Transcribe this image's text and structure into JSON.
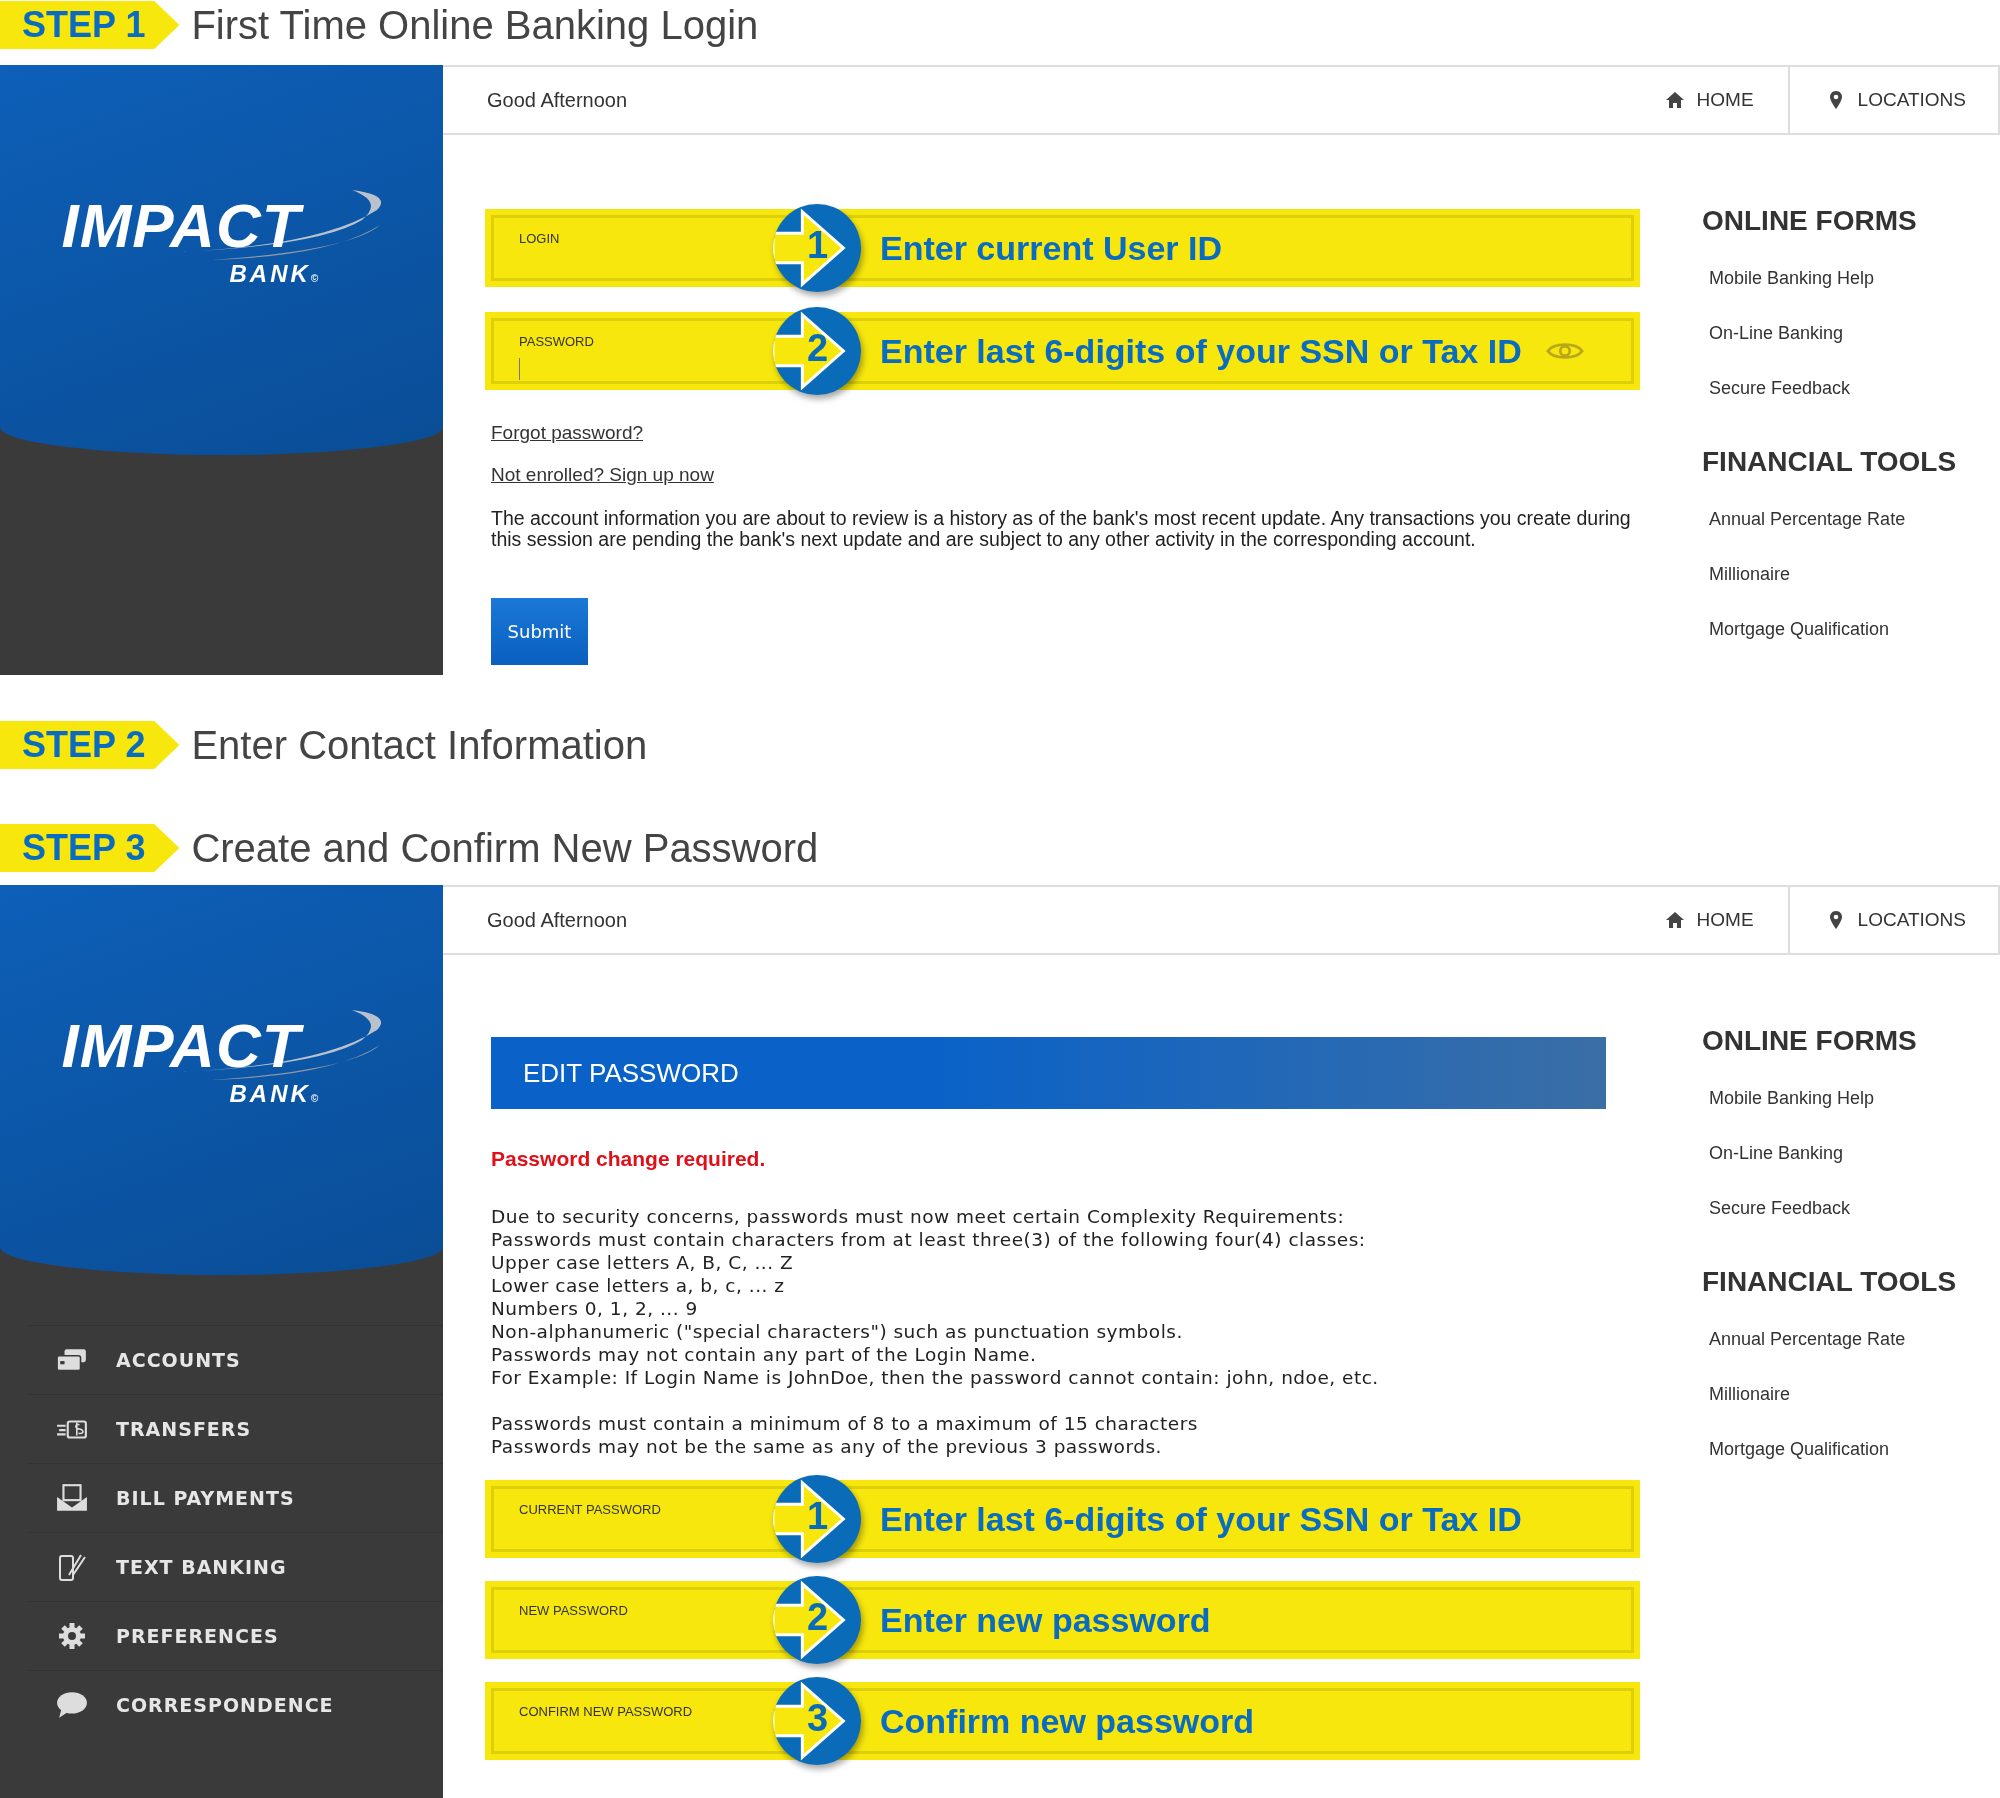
{
  "step_1": {
    "label": "STEP 1",
    "title": "First Time Online Banking Login"
  },
  "login_screen": {
    "logo": {
      "name": "IMPACT",
      "sub": "BANK",
      "mark": "©"
    },
    "greeting": "Good Afternoon",
    "top_nav": [
      {
        "label": "HOME"
      },
      {
        "label": "LOCATIONS"
      }
    ],
    "fields": [
      {
        "label": "LOGIN",
        "number": "1",
        "instruction": "Enter current User ID",
        "focused": false,
        "reveal_toggle": false
      },
      {
        "label": "PASSWORD",
        "number": "2",
        "instruction": "Enter last 6-digits of your SSN or Tax ID",
        "focused": true,
        "reveal_toggle": true
      }
    ],
    "links": [
      "Forgot password?",
      "Not enrolled? Sign up now"
    ],
    "notice": "The account information you are about to review is a history as of the bank's most recent update. Any transactions you create during this session are pending the bank's next update and are subject to any other activity in the corresponding account.",
    "submit": "Submit",
    "side_sections": [
      {
        "heading": "ONLINE FORMS",
        "items": [
          "Mobile Banking Help",
          "On-Line Banking",
          "Secure Feedback"
        ]
      },
      {
        "heading": "FINANCIAL TOOLS",
        "items": [
          "Annual Percentage Rate",
          "Millionaire",
          "Mortgage Qualification"
        ]
      }
    ]
  },
  "step_2": {
    "label": "STEP 2",
    "title": "Enter Contact Information"
  },
  "step_3": {
    "label": "STEP 3",
    "title": "Create and Confirm New Password"
  },
  "password_screen": {
    "logo": {
      "name": "IMPACT",
      "sub": "BANK",
      "mark": "©"
    },
    "greeting": "Good Afternoon",
    "top_nav": [
      {
        "label": "HOME"
      },
      {
        "label": "LOCATIONS"
      }
    ],
    "menu": [
      {
        "label": "ACCOUNTS"
      },
      {
        "label": "TRANSFERS"
      },
      {
        "label": "BILL PAYMENTS"
      },
      {
        "label": "TEXT BANKING"
      },
      {
        "label": "PREFERENCES"
      },
      {
        "label": "CORRESPONDENCE"
      }
    ],
    "panel_title": "EDIT PASSWORD",
    "alert": "Password change required.",
    "requirements": [
      [
        "Due to security concerns, passwords must now meet certain Complexity Requirements:",
        "Passwords must contain characters from at least three(3) of the following four(4) classes:",
        "Upper case letters A, B, C, ... Z",
        "Lower case letters a, b, c, ... z",
        "Numbers 0, 1, 2, ... 9",
        "Non-alphanumeric (\"special characters\") such as punctuation symbols.",
        "Passwords may not contain any part of the Login Name.",
        "For Example: If Login Name is JohnDoe, then the password cannot contain: john, ndoe, etc."
      ],
      [
        "Passwords must contain a minimum of 8 to a maximum of 15 characters",
        "Passwords may not be the same as any of the previous 3 passwords."
      ]
    ],
    "fields": [
      {
        "label": "CURRENT PASSWORD",
        "number": "1",
        "instruction": "Enter last 6-digits of your SSN or Tax ID",
        "focused": false,
        "reveal_toggle": false
      },
      {
        "label": "NEW PASSWORD",
        "number": "2",
        "instruction": "Enter new password",
        "focused": false,
        "reveal_toggle": false
      },
      {
        "label": "CONFIRM NEW PASSWORD",
        "number": "3",
        "instruction": "Confirm new password",
        "focused": false,
        "reveal_toggle": false
      }
    ],
    "side_sections": [
      {
        "heading": "ONLINE FORMS",
        "items": [
          "Mobile Banking Help",
          "On-Line Banking",
          "Secure Feedback"
        ]
      },
      {
        "heading": "FINANCIAL TOOLS",
        "items": [
          "Annual Percentage Rate",
          "Millionaire",
          "Mortgage Qualification"
        ]
      }
    ]
  }
}
